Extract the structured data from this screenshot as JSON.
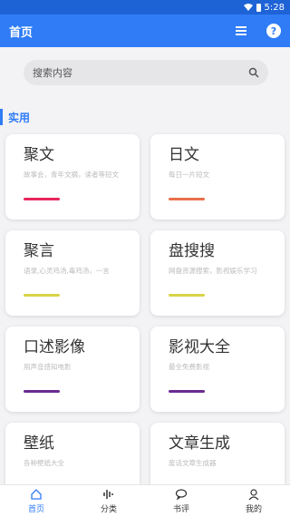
{
  "status": {
    "time": "5:28"
  },
  "appbar": {
    "title": "首页",
    "menu_icon": "list-icon",
    "help_icon": "help-icon",
    "help_glyph": "?"
  },
  "search": {
    "placeholder": "搜索内容",
    "icon": "search-icon"
  },
  "section": {
    "label": "实用"
  },
  "cards": [
    {
      "title": "聚文",
      "desc": "故事会，青年文摘，读者等短文",
      "color": "#e8265e"
    },
    {
      "title": "日文",
      "desc": "每日一片短文",
      "color": "#e8704a"
    },
    {
      "title": "聚言",
      "desc": "语录,心灵鸡汤,毒鸡汤，一言",
      "color": "#d8d448"
    },
    {
      "title": "盘搜搜",
      "desc": "网盘资源搜索，影视娱乐学习",
      "color": "#d8d448"
    },
    {
      "title": "口述影像",
      "desc": "用声音感知电影",
      "color": "#6a2b8f"
    },
    {
      "title": "影视大全",
      "desc": "最全免费影视",
      "color": "#6a2b8f"
    },
    {
      "title": "壁纸",
      "desc": "各种壁纸大全",
      "color": "#ffffff"
    },
    {
      "title": "文章生成",
      "desc": "废话文章生成器",
      "color": "#ffffff"
    }
  ],
  "tabs": [
    {
      "label": "首页",
      "icon": "home-icon",
      "active": true
    },
    {
      "label": "分类",
      "icon": "waveform-icon",
      "active": false
    },
    {
      "label": "书评",
      "icon": "chat-icon",
      "active": false
    },
    {
      "label": "我的",
      "icon": "user-icon",
      "active": false
    }
  ]
}
